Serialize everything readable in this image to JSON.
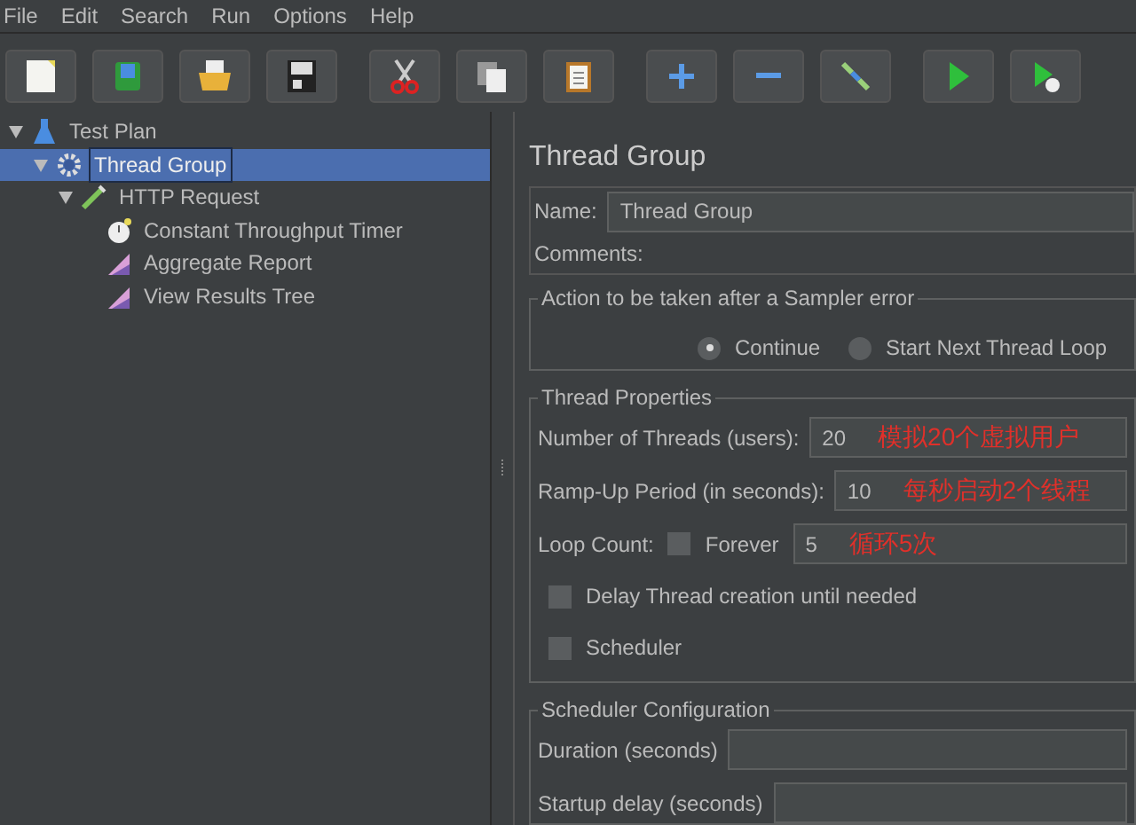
{
  "menu": [
    "File",
    "Edit",
    "Search",
    "Run",
    "Options",
    "Help"
  ],
  "toolbar": [
    {
      "kind": "new"
    },
    {
      "kind": "templates"
    },
    {
      "kind": "open"
    },
    {
      "kind": "save"
    },
    {
      "kind": "cut"
    },
    {
      "kind": "copy"
    },
    {
      "kind": "paste"
    },
    {
      "kind": "add"
    },
    {
      "kind": "remove"
    },
    {
      "kind": "toggle"
    },
    {
      "kind": "start"
    },
    {
      "kind": "start-no-pause"
    }
  ],
  "tree": [
    {
      "label": "Test Plan",
      "kind": "plan",
      "selected": false,
      "expanded": true,
      "children": [
        {
          "label": "Thread Group",
          "kind": "threads",
          "selected": true,
          "expanded": true,
          "children": [
            {
              "label": "HTTP Request",
              "kind": "sampler",
              "selected": false,
              "expanded": true,
              "children": [
                {
                  "label": "Constant Throughput Timer",
                  "kind": "timer",
                  "selected": false
                },
                {
                  "label": "Aggregate Report",
                  "kind": "listener",
                  "selected": false
                },
                {
                  "label": "View Results Tree",
                  "kind": "listener",
                  "selected": false
                }
              ]
            }
          ]
        }
      ]
    }
  ],
  "details": {
    "title": "Thread Group",
    "name": {
      "label": "Name:",
      "value": "Thread Group"
    },
    "comments": {
      "label": "Comments:"
    },
    "error_action": {
      "legend": "Action to be taken after a Sampler error",
      "options": [
        {
          "label": "Continue",
          "selected": true
        },
        {
          "label": "Start Next Thread Loop",
          "selected": false
        }
      ]
    },
    "thread_properties": {
      "legend": "Thread Properties",
      "threads": {
        "label": "Number of Threads (users):",
        "value": "20",
        "note": "模拟20个虚拟用户"
      },
      "ramp_up": {
        "label": "Ramp-Up Period (in seconds):",
        "value": "10",
        "note": "每秒启动2个线程"
      },
      "loop": {
        "label": "Loop Count:",
        "forever": {
          "label": "Forever",
          "checked": false
        },
        "value": "5",
        "note": "循环5次"
      },
      "delay": {
        "label": "Delay Thread creation until needed",
        "checked": false
      },
      "scheduler": {
        "label": "Scheduler",
        "checked": false
      }
    },
    "scheduler_config": {
      "legend": "Scheduler Configuration",
      "duration": {
        "label": "Duration (seconds)"
      },
      "startup_delay": {
        "label": "Startup delay (seconds)"
      }
    }
  }
}
